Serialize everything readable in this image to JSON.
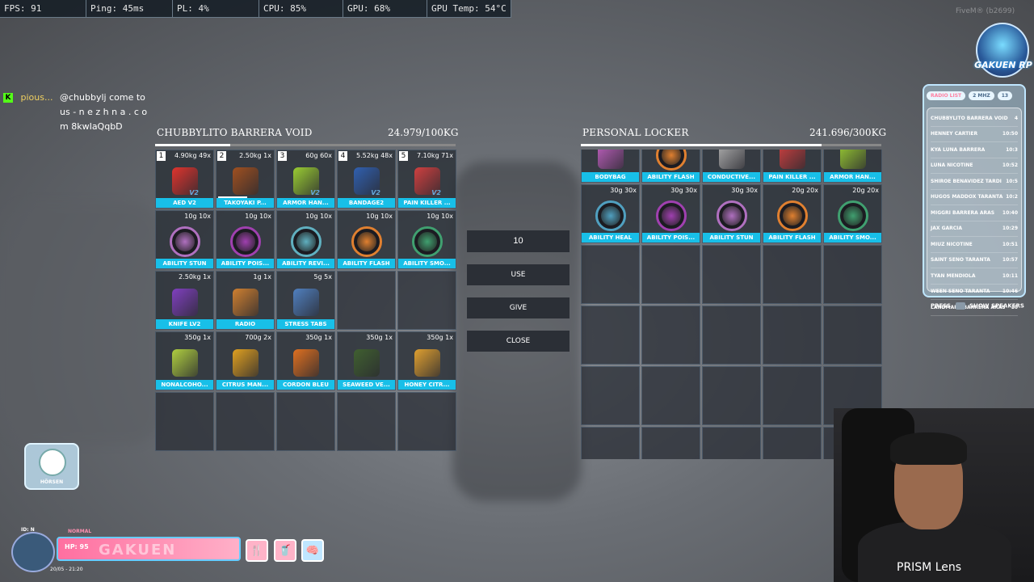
{
  "status_bar": [
    {
      "label": "FPS: 91"
    },
    {
      "label": "Ping: 45ms"
    },
    {
      "label": "PL: 4%"
    },
    {
      "label": "CPU: 85%"
    },
    {
      "label": "GPU: 68%"
    },
    {
      "label": "GPU Temp: 54°C"
    }
  ],
  "watermark": "FiveM® (b2699)",
  "chat": {
    "platform_icon": "K",
    "user": "pious...",
    "message": "@chubbylj come to us - n e z h n a . c o m 8kwIaQqbD"
  },
  "logo": {
    "text": "GAKUEN RP"
  },
  "radio": {
    "title": "RADIO LIST",
    "tags": [
      "2 MHZ",
      "13"
    ],
    "entries": [
      {
        "name": "CHUBBYLITO BARRERA VOID",
        "time": "4"
      },
      {
        "name": "HENNEY CARTIER",
        "time": "10:50"
      },
      {
        "name": "KYA LUNA BARRERA",
        "time": "10:3"
      },
      {
        "name": "LUNA NICOTINE",
        "time": "10:52"
      },
      {
        "name": "SHIROE BENAVIDEZ TARDI",
        "time": "10:5"
      },
      {
        "name": "HUGOS MADDOX TARANTA",
        "time": "10:2"
      },
      {
        "name": "MIGGRI BARRERA ARAS",
        "time": "10:40"
      },
      {
        "name": "JAX GARCIA",
        "time": "10:29"
      },
      {
        "name": "MIUZ NICOTINE",
        "time": "10:51"
      },
      {
        "name": "SAINT SENO TARANTA",
        "time": "10:57"
      },
      {
        "name": "TYAN MENDIOLA",
        "time": "10:11"
      },
      {
        "name": "WEEN SENO TARANTA",
        "time": "10:46"
      },
      {
        "name": "LANDMARK BARRERA ARAS",
        "time": "10"
      }
    ],
    "footer": "PRESS",
    "footer_key": "",
    "footer_action": "SHOW SPEAKERS"
  },
  "player_inventory": {
    "title": "CHUBBYLITO BARRERA VOID",
    "weight": "24.979/100KG",
    "weight_fraction": 0.25,
    "slots": [
      {
        "num": "1",
        "wt": "4.90kg 49x",
        "label": "AED V2",
        "icon": "aed-icon",
        "color": "#e0342e",
        "v2": true
      },
      {
        "num": "2",
        "wt": "2.50kg 1x",
        "label": "TAKOYAKI P...",
        "icon": "takoyaki-pick-icon",
        "color": "#a05020",
        "dura": true
      },
      {
        "num": "3",
        "wt": "60g 60x",
        "label": "ARMOR HAN...",
        "icon": "armor-icon",
        "color": "#9acd32",
        "v2": true
      },
      {
        "num": "4",
        "wt": "5.52kg 48x",
        "label": "BANDAGE2",
        "icon": "bandage-icon",
        "color": "#3060b0",
        "v2": true
      },
      {
        "num": "5",
        "wt": "7.10kg 71x",
        "label": "PAIN KILLER ...",
        "icon": "pills-icon",
        "color": "#d04040",
        "v2": true
      },
      {
        "wt": "10g 10x",
        "label": "ABILITY STUN",
        "icon": "stun-coin-icon",
        "color": "#b070c0"
      },
      {
        "wt": "10g 10x",
        "label": "ABILITY POIS...",
        "icon": "poison-coin-icon",
        "color": "#a040b0"
      },
      {
        "wt": "10g 10x",
        "label": "ABILITY REVI...",
        "icon": "revive-coin-icon",
        "color": "#60b0c0"
      },
      {
        "wt": "10g 10x",
        "label": "ABILITY FLASH",
        "icon": "flash-coin-icon",
        "color": "#e08030"
      },
      {
        "wt": "10g 10x",
        "label": "ABILITY SMO...",
        "icon": "smoke-coin-icon",
        "color": "#40a070"
      },
      {
        "wt": "2.50kg 1x",
        "label": "KNIFE LV2",
        "icon": "knife-icon",
        "color": "#8040c0"
      },
      {
        "wt": "1g 1x",
        "label": "RADIO",
        "icon": "radio-icon",
        "color": "#d08030"
      },
      {
        "wt": "5g 5x",
        "label": "STRESS TABS",
        "icon": "stress-tabs-icon",
        "color": "#5080c0"
      },
      {
        "empty": true
      },
      {
        "empty": true
      },
      {
        "wt": "350g 1x",
        "label": "NONALCOHO...",
        "icon": "cocktail-icon",
        "color": "#b0d040"
      },
      {
        "wt": "700g 2x",
        "label": "CITRUS MAN...",
        "icon": "citrus-jar-icon",
        "color": "#e0a020"
      },
      {
        "wt": "350g 1x",
        "label": "CORDON BLEU",
        "icon": "cordon-bleu-icon",
        "color": "#e07020"
      },
      {
        "wt": "350g 1x",
        "label": "SEAWEED VE...",
        "icon": "seaweed-icon",
        "color": "#406030"
      },
      {
        "wt": "350g 1x",
        "label": "HONEY CITR...",
        "icon": "honey-jar-icon",
        "color": "#e0a030"
      },
      {
        "empty": true
      },
      {
        "empty": true
      },
      {
        "empty": true
      },
      {
        "empty": true
      },
      {
        "empty": true
      }
    ]
  },
  "controls": {
    "amount": "10",
    "use": "USE",
    "give": "GIVE",
    "close": "CLOSE"
  },
  "locker": {
    "title": "PERSONAL LOCKER",
    "weight": "241.696/300KG",
    "weight_fraction": 0.8,
    "top_row": [
      {
        "label": "BODYBAG",
        "icon": "bodybag-icon",
        "color": "#c060c0"
      },
      {
        "label": "ABILITY FLASH",
        "icon": "flash-coin-icon",
        "color": "#e08030"
      },
      {
        "label": "CONDUCTIVE...",
        "icon": "conductive-icon",
        "color": "#b0b0b0"
      },
      {
        "label": "PAIN KILLER ...",
        "icon": "pills-icon",
        "color": "#d04040"
      },
      {
        "label": "ARMOR HAN...",
        "icon": "armor-icon",
        "color": "#9acd32"
      }
    ],
    "slots": [
      {
        "wt": "30g 30x",
        "label": "ABILITY HEAL",
        "icon": "heal-coin-icon",
        "color": "#50a0c0"
      },
      {
        "wt": "30g 30x",
        "label": "ABILITY POIS...",
        "icon": "poison-coin-icon",
        "color": "#a040b0"
      },
      {
        "wt": "30g 30x",
        "label": "ABILITY STUN",
        "icon": "stun-coin-icon",
        "color": "#b070c0"
      },
      {
        "wt": "20g 20x",
        "label": "ABILITY FLASH",
        "icon": "flash-coin-icon",
        "color": "#e08030"
      },
      {
        "wt": "20g 20x",
        "label": "ABILITY SMO...",
        "icon": "smoke-coin-icon",
        "color": "#40a070"
      }
    ]
  },
  "hud": {
    "badge": "HÖRSEN",
    "hp": "HP: 95",
    "hp_bg": "GAKUEN",
    "level": "ID: N",
    "mode": "NORMAL",
    "date": "20/05 - 21:20"
  },
  "webcam": {
    "overlay": "PRISM Lens"
  }
}
